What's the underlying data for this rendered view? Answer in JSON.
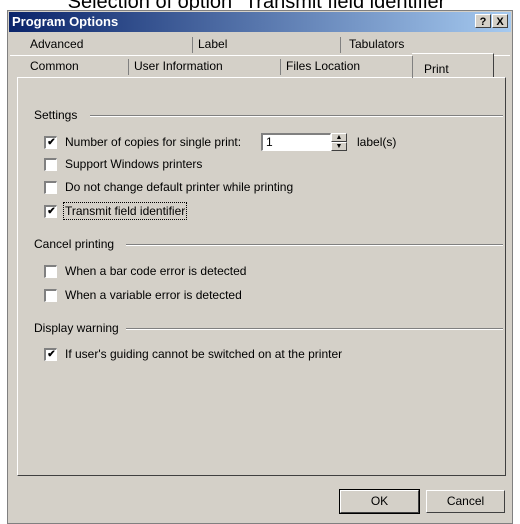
{
  "caption": "Selection of option \"Transmit field identifier\"",
  "window": {
    "title": "Program Options",
    "help_glyph": "?",
    "close_glyph": "X"
  },
  "tabs": {
    "row1": [
      "Advanced",
      "Label",
      "Tabulators"
    ],
    "row2": [
      "Common",
      "User Information",
      "Files Location",
      "Print"
    ],
    "active": "Print"
  },
  "settings": {
    "label": "Settings",
    "copies_label": "Number of copies for single print:",
    "copies_value": "1",
    "copies_unit": "label(s)",
    "copies_checked": true,
    "support_windows_printers": "Support Windows printers",
    "support_windows_printers_checked": false,
    "no_change_default": "Do not change default printer while printing",
    "no_change_default_checked": false,
    "transmit_field_identifier": "Transmit field identifier",
    "transmit_field_identifier_checked": true
  },
  "cancel_printing": {
    "label": "Cancel printing",
    "barcode_error": "When a bar code error is detected",
    "barcode_error_checked": false,
    "variable_error": "When a variable error is detected",
    "variable_error_checked": false
  },
  "display_warning": {
    "label": "Display warning",
    "guiding": "If user's guiding cannot be switched on at the printer",
    "guiding_checked": true
  },
  "buttons": {
    "ok": "OK",
    "cancel": "Cancel"
  }
}
